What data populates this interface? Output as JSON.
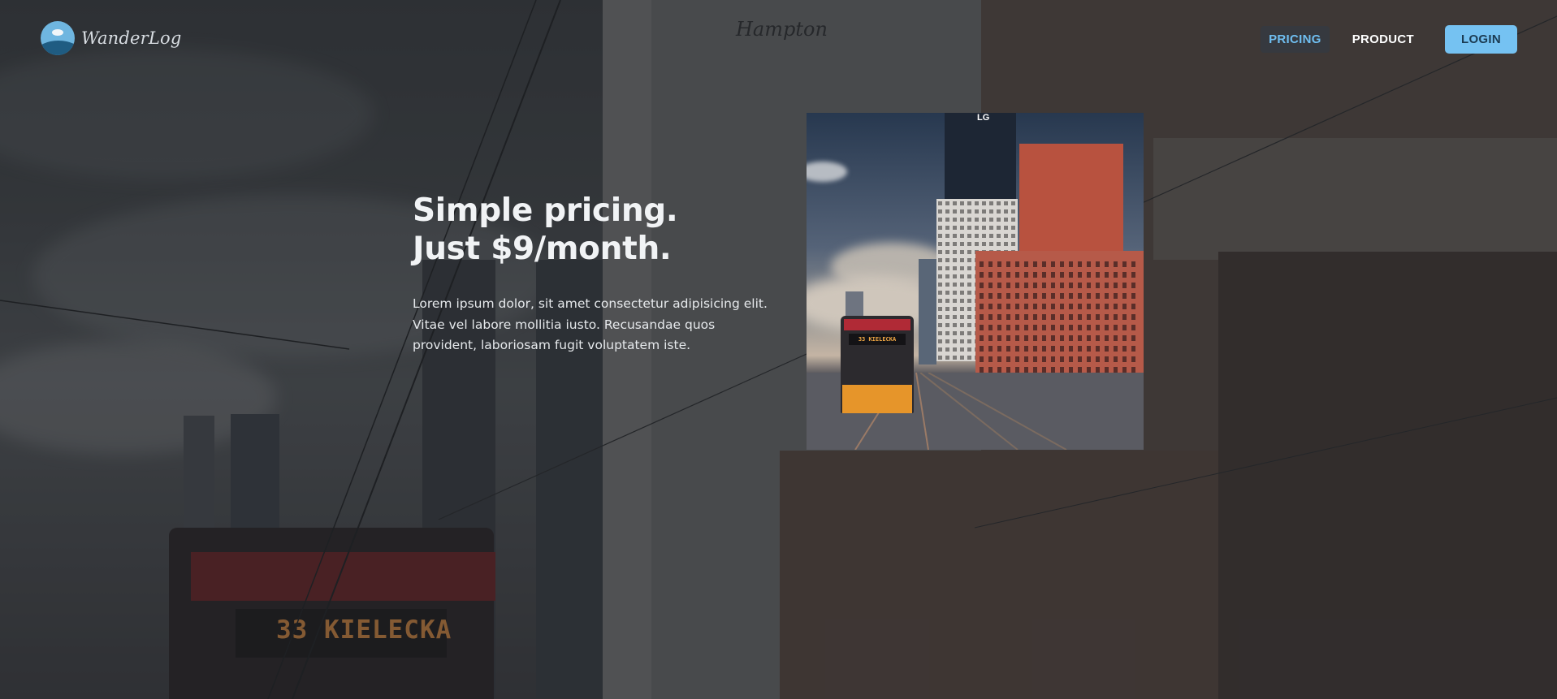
{
  "brand": {
    "name": "WanderLog"
  },
  "nav": {
    "items": [
      {
        "label": "PRICING",
        "active": true
      },
      {
        "label": "PRODUCT",
        "active": false
      }
    ],
    "login_label": "LOGIN"
  },
  "hero": {
    "title_line1": "Simple pricing.",
    "title_line2": "Just $9/month.",
    "body_lines": [
      "Lorem ipsum dolor, sit amet consectetur adipisicing elit.",
      "Vitae vel labore mollitia iusto. Recusandae quos",
      "provident, laboriosam fugit voluptatem iste."
    ]
  },
  "background": {
    "tram_sign": "33 KIELECKA",
    "hotel_sign": "Hampton"
  },
  "photo": {
    "tram_sign": "33 KIELECKA",
    "rooftop_sign": "LG"
  },
  "colors": {
    "accent": "#75c2f2",
    "active_link": "#6fbef0",
    "heading": "#f1f3f5"
  }
}
